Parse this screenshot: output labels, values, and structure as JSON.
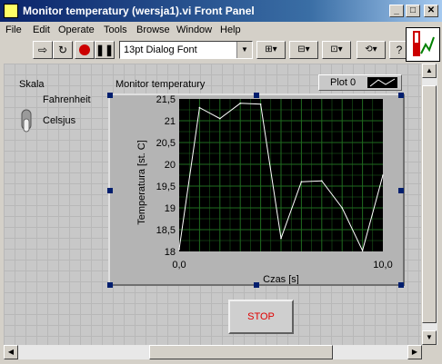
{
  "window": {
    "title": "Monitor temperatury (wersja1).vi Front Panel"
  },
  "menu": [
    "File",
    "Edit",
    "Operate",
    "Tools",
    "Browse",
    "Window",
    "Help"
  ],
  "toolbar": {
    "font": "13pt Dialog Font"
  },
  "switch": {
    "label": "Skala",
    "top_option": "Fahrenheit",
    "bottom_option": "Celsjus",
    "state": "Celsjus"
  },
  "graph": {
    "label": "Monitor temperatury",
    "legend": "Plot 0"
  },
  "stop_button": {
    "label": "STOP"
  },
  "colors": {
    "plot_bg": "#000000",
    "grid": "#1f6b1f",
    "trace": "#ffffff",
    "title_bar": "#0a246a",
    "stop_text": "#e00000"
  },
  "chart_data": {
    "type": "line",
    "xlabel": "Czas [s]",
    "ylabel": "Temperatura [st. C]",
    "xlim": [
      0,
      10
    ],
    "ylim": [
      18,
      21.5
    ],
    "x_ticks": [
      "0,0",
      "10,0"
    ],
    "y_ticks": [
      "18",
      "18,5",
      "19",
      "19,5",
      "20",
      "20,5",
      "21",
      "21,5"
    ],
    "grid": true,
    "legend": "top-right",
    "series": [
      {
        "name": "Plot 0",
        "x": [
          0,
          1,
          2,
          3,
          4,
          5,
          6,
          7,
          8,
          9,
          10
        ],
        "y": [
          18.05,
          21.3,
          21.05,
          21.4,
          21.38,
          18.3,
          19.6,
          19.62,
          19.0,
          18.02,
          19.75
        ]
      }
    ]
  }
}
